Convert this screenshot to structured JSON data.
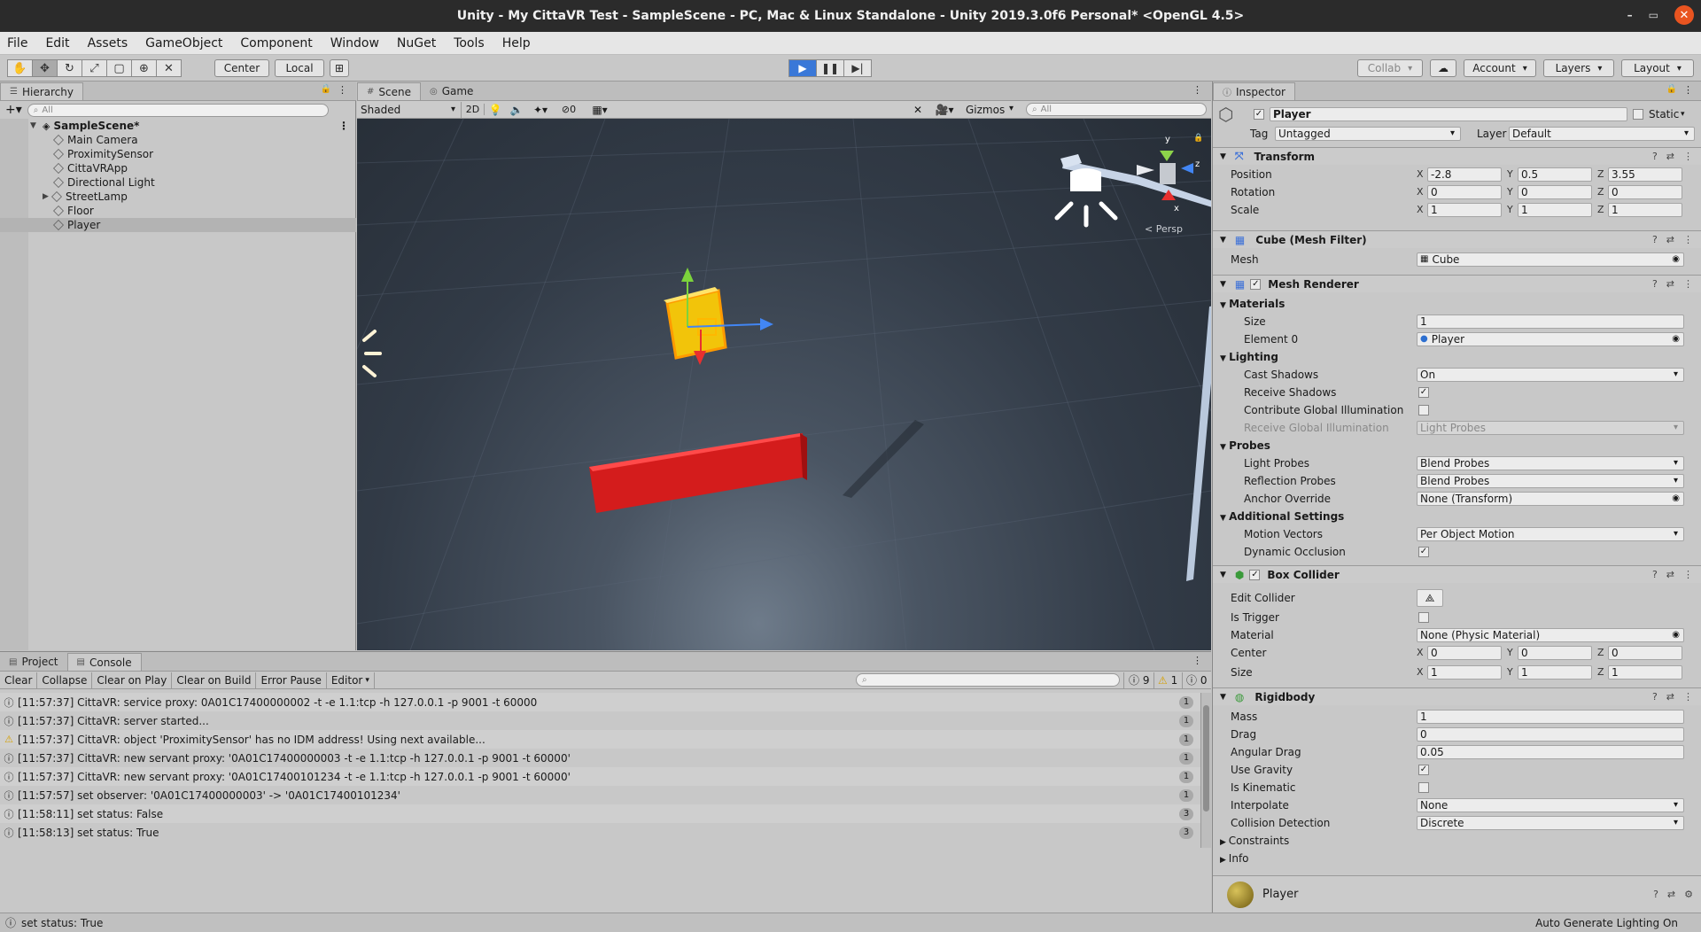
{
  "window": {
    "title": "Unity - My CittaVR Test - SampleScene - PC, Mac & Linux Standalone - Unity 2019.3.0f6 Personal* <OpenGL 4.5>"
  },
  "menu": [
    "File",
    "Edit",
    "Assets",
    "GameObject",
    "Component",
    "Window",
    "NuGet",
    "Tools",
    "Help"
  ],
  "toolbar": {
    "center": "Center",
    "local": "Local",
    "collab": "Collab",
    "account": "Account",
    "layers": "Layers",
    "layout": "Layout"
  },
  "hierarchy": {
    "tab": "Hierarchy",
    "search_placeholder": "All",
    "scene": "SampleScene*",
    "items": [
      "Main Camera",
      "ProximitySensor",
      "CittaVRApp",
      "Directional Light",
      "StreetLamp",
      "Floor",
      "Player"
    ]
  },
  "scene": {
    "tabs": [
      "Scene",
      "Game"
    ],
    "shading": "Shaded",
    "mode_2d": "2D",
    "hidden_count": "0",
    "gizmos": "Gizmos",
    "search_placeholder": "All",
    "persp": "< Persp",
    "axis_y": "y",
    "axis_z": "z",
    "axis_x": "x"
  },
  "inspector": {
    "tab": "Inspector",
    "object_name": "Player",
    "static": "Static",
    "tag_label": "Tag",
    "tag": "Untagged",
    "layer_label": "Layer",
    "layer": "Default",
    "transform": {
      "title": "Transform",
      "position_label": "Position",
      "position": [
        "-2.8",
        "0.5",
        "3.55"
      ],
      "rotation_label": "Rotation",
      "rotation": [
        "0",
        "0",
        "0"
      ],
      "scale_label": "Scale",
      "scale": [
        "1",
        "1",
        "1"
      ]
    },
    "mesh_filter": {
      "title": "Cube (Mesh Filter)",
      "mesh_label": "Mesh",
      "mesh": "Cube"
    },
    "mesh_renderer": {
      "title": "Mesh Renderer",
      "materials": "Materials",
      "size_label": "Size",
      "size": "1",
      "element0_label": "Element 0",
      "element0": "Player",
      "lighting": "Lighting",
      "cast_shadows_label": "Cast Shadows",
      "cast_shadows": "On",
      "receive_shadows_label": "Receive Shadows",
      "contribute_gi_label": "Contribute Global Illumination",
      "receive_gi_label": "Receive Global Illumination",
      "receive_gi": "Light Probes",
      "probes": "Probes",
      "light_probes_label": "Light Probes",
      "light_probes": "Blend Probes",
      "reflection_probes_label": "Reflection Probes",
      "reflection_probes": "Blend Probes",
      "anchor_override_label": "Anchor Override",
      "anchor_override": "None (Transform)",
      "additional": "Additional Settings",
      "motion_vectors_label": "Motion Vectors",
      "motion_vectors": "Per Object Motion",
      "dynamic_occlusion_label": "Dynamic Occlusion"
    },
    "box_collider": {
      "title": "Box Collider",
      "edit_collider_label": "Edit Collider",
      "is_trigger_label": "Is Trigger",
      "material_label": "Material",
      "material": "None (Physic Material)",
      "center_label": "Center",
      "center": [
        "0",
        "0",
        "0"
      ],
      "size_label": "Size",
      "size": [
        "1",
        "1",
        "1"
      ]
    },
    "rigidbody": {
      "title": "Rigidbody",
      "mass_label": "Mass",
      "mass": "1",
      "drag_label": "Drag",
      "drag": "0",
      "angular_drag_label": "Angular Drag",
      "angular_drag": "0.05",
      "use_gravity_label": "Use Gravity",
      "is_kinematic_label": "Is Kinematic",
      "interpolate_label": "Interpolate",
      "interpolate": "None",
      "collision_label": "Collision Detection",
      "collision": "Discrete",
      "constraints": "Constraints",
      "info": "Info"
    },
    "material_preview": "Player"
  },
  "console": {
    "tabs": [
      "Project",
      "Console"
    ],
    "buttons": [
      "Clear",
      "Collapse",
      "Clear on Play",
      "Clear on Build",
      "Error Pause",
      "Editor"
    ],
    "counts": {
      "info": "9",
      "warn": "1",
      "error": "0"
    },
    "logs": [
      {
        "level": "info",
        "text": "[11:57:37] CittaVR: service proxy: 0A01C17400000002 -t -e 1.1:tcp -h 127.0.0.1 -p 9001 -t 60000",
        "count": "1"
      },
      {
        "level": "info",
        "text": "[11:57:37] CittaVR: server started...",
        "count": "1"
      },
      {
        "level": "warn",
        "text": "[11:57:37] CittaVR: object 'ProximitySensor' has no IDM address! Using next available...",
        "count": "1"
      },
      {
        "level": "info",
        "text": "[11:57:37] CittaVR: new servant proxy: '0A01C17400000003 -t -e 1.1:tcp -h 127.0.0.1 -p 9001 -t 60000'",
        "count": "1"
      },
      {
        "level": "info",
        "text": "[11:57:37] CittaVR: new servant proxy: '0A01C17400101234 -t -e 1.1:tcp -h 127.0.0.1 -p 9001 -t 60000'",
        "count": "1"
      },
      {
        "level": "info",
        "text": "[11:57:57] set observer: '0A01C17400000003' -> '0A01C17400101234'",
        "count": "1"
      },
      {
        "level": "info",
        "text": "[11:58:11] set status: False",
        "count": "3"
      },
      {
        "level": "info",
        "text": "[11:58:13] set status: True",
        "count": "3"
      }
    ]
  },
  "status": {
    "message": "set status: True",
    "right": "Auto Generate Lighting On"
  }
}
